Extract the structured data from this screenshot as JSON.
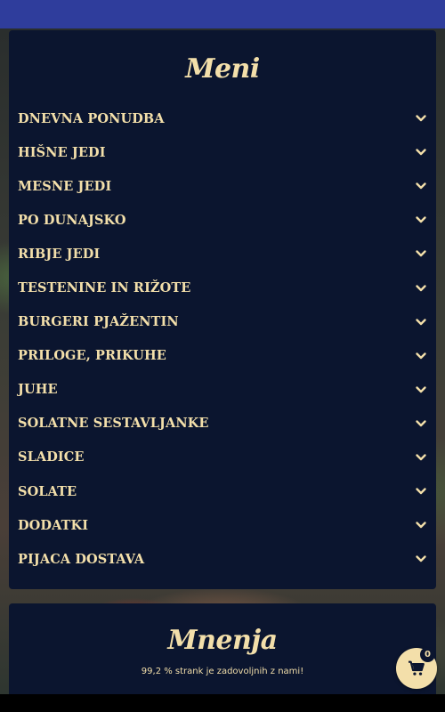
{
  "menu": {
    "title": "Meni",
    "items": [
      {
        "label": "DNEVNA PONUDBA"
      },
      {
        "label": "HIŠNE JEDI"
      },
      {
        "label": "MESNE JEDI"
      },
      {
        "label": "PO DUNAJSKO"
      },
      {
        "label": "RIBJE JEDI"
      },
      {
        "label": "TESTENINE IN RIŽOTE"
      },
      {
        "label": "BURGERI PJAŽENTIN"
      },
      {
        "label": "PRILOGE, PRIKUHE"
      },
      {
        "label": "JUHE"
      },
      {
        "label": "SOLATNE SESTAVLJANKE"
      },
      {
        "label": "SLADICE"
      },
      {
        "label": "SOLATE"
      },
      {
        "label": "DODATKI"
      },
      {
        "label": "PIJACA DOSTAVA"
      }
    ],
    "expand_icon": "chevron-down-icon"
  },
  "reviews": {
    "title": "Mnenja",
    "subtitle": "99,2 % strank je zadovoljnih z nami!"
  },
  "cart": {
    "icon": "cart-icon",
    "count": "0"
  },
  "colors": {
    "topbar": "#2f3d9c",
    "card": "#0b152f",
    "accent": "#f3dfaa"
  }
}
